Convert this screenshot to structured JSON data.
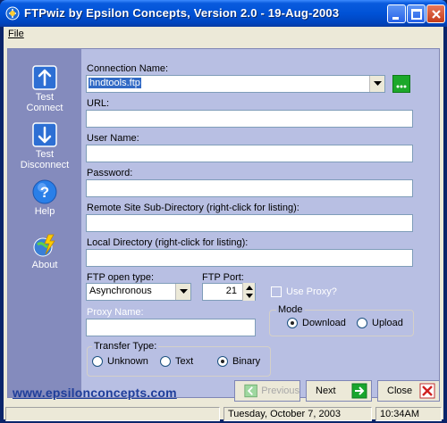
{
  "window": {
    "title": "FTPwiz by Epsilon Concepts, Version 2.0 - 19-Aug-2003"
  },
  "menu": {
    "file": "File"
  },
  "sidebar": {
    "items": [
      {
        "label_line1": "Test",
        "label_line2": "Connect",
        "icon": "up-arrow-icon"
      },
      {
        "label_line1": "Test",
        "label_line2": "Disconnect",
        "icon": "down-arrow-icon"
      },
      {
        "label_line1": "Help",
        "label_line2": "",
        "icon": "help-icon"
      },
      {
        "label_line1": "About",
        "label_line2": "",
        "icon": "about-icon"
      }
    ]
  },
  "form": {
    "connection_name_label": "Connection Name:",
    "connection_name_value": "hndtools.ftp",
    "url_label": "URL:",
    "url_value": "",
    "username_label": "User Name:",
    "username_value": "",
    "password_label": "Password:",
    "password_value": "",
    "remote_dir_label": "Remote Site Sub-Directory (right-click for listing):",
    "remote_dir_value": "",
    "local_dir_label": "Local Directory (right-click for listing):",
    "local_dir_value": "",
    "ftp_open_type_label": "FTP open type:",
    "ftp_open_type_value": "Asynchronous",
    "ftp_port_label": "FTP Port:",
    "ftp_port_value": "21",
    "use_proxy_label": "Use Proxy?",
    "proxy_name_label": "Proxy Name:",
    "proxy_name_value": "",
    "mode": {
      "title": "Mode",
      "options": [
        "Download",
        "Upload"
      ],
      "selected": "Download"
    },
    "transfer_type": {
      "title": "Transfer Type:",
      "options": [
        "Unknown",
        "Text",
        "Binary"
      ],
      "selected": "Binary"
    }
  },
  "footer": {
    "website": "www.epsilonconcepts.com",
    "previous_label": "Previous",
    "next_label": "Next",
    "close_label": "Close"
  },
  "status": {
    "date": "Tuesday, October  7, 2003",
    "time": "10:34AM"
  },
  "colors": {
    "titlebar": "#0052d6",
    "sidebar": "#848bbd",
    "form_bg": "#b8bfe3",
    "link": "#1f3e9a"
  }
}
